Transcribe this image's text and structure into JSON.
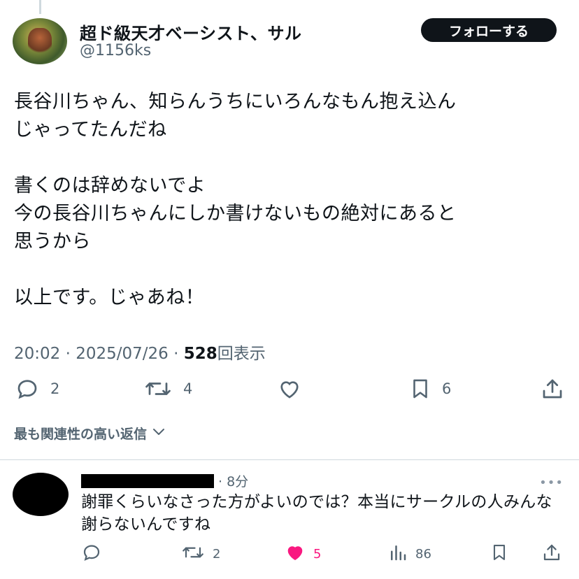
{
  "tweet": {
    "display_name": "超ド級天才ベーシスト、サル",
    "handle": "@1156ks",
    "follow_label": "フォローする",
    "lines": [
      "長谷川ちゃん、知らんうちにいろんなもん抱え込ん",
      "じゃってたんだね",
      "",
      "書くのは辞めないでよ",
      "今の長谷川ちゃんにしか書けないもの絶対にあると",
      "思うから",
      "",
      "以上です。じゃあね！"
    ],
    "time": "20:02",
    "date": "2025/07/26",
    "separator": " · ",
    "views_count": "528",
    "views_label": "回表示"
  },
  "actions": {
    "replies": "2",
    "retweets": "4",
    "likes": "",
    "bookmarks": "6"
  },
  "sort": {
    "label": "最も関連性の高い返信"
  },
  "reply": {
    "time": "· 8分",
    "more": "•••",
    "text": "謝罪くらいなさった方がよいのでは？本当にサークルの人みんな謝らないんですね",
    "replies": "",
    "retweets": "2",
    "likes": "5",
    "views": "86"
  },
  "colors": {
    "text": "#0f1419",
    "secondary": "#536471",
    "like": "#f91880",
    "divider": "#cfd9de"
  },
  "icons": [
    "reply-icon",
    "retweet-icon",
    "like-icon",
    "bookmark-icon",
    "share-icon",
    "views-icon",
    "chevron-down-icon",
    "more-icon"
  ]
}
